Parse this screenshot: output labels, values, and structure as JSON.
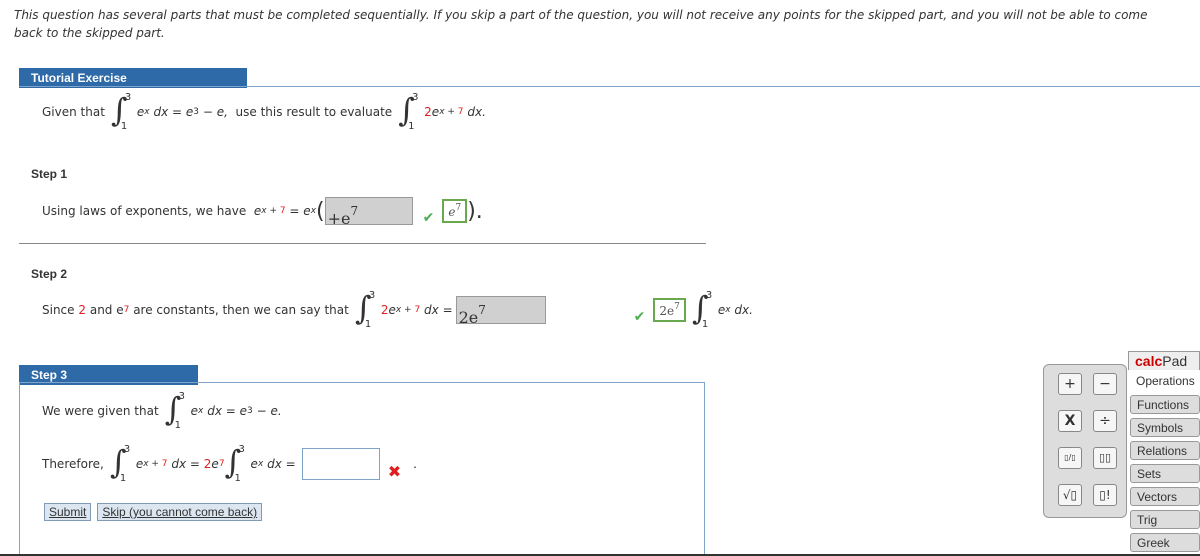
{
  "notice": "This question has several parts that must be completed sequentially. If you skip a part of the question, you will not receive any points for the skipped part, and you will not be able to come back to the skipped part.",
  "header": "Tutorial Exercise",
  "intro": {
    "given": "Given that",
    "upper": "3",
    "lower": "1",
    "e": "e",
    "x": "x",
    "dx": "dx",
    "eq": "= e",
    "three": "3",
    "tail": "− e,",
    "mid": "use this result to evaluate",
    "two": "2",
    "xp": "x + ",
    "seven": "7",
    "dx2": "dx."
  },
  "step1": {
    "title": "Step 1",
    "text": "Using laws of exponents, we have",
    "e": "e",
    "xp": "x + ",
    "seven": "7",
    "eq": "= e",
    "x": "x",
    "paren": "(",
    "answer": "+e",
    "answer_exp": "7",
    "correct": "e",
    "correct_exp": "7",
    "close": ")."
  },
  "step2": {
    "title": "Step 2",
    "since": "Since",
    "two": "2",
    "and": "and e",
    "seven": "7",
    "rest": "are constants, then we can say that",
    "upper": "3",
    "lower": "1",
    "e": "e",
    "xp": "x + ",
    "dx": "dx =",
    "answer": "2e",
    "answer_exp": "7",
    "correct": "2e",
    "correct_exp": "7",
    "x": "x",
    "dx2": "dx."
  },
  "step3": {
    "title": "Step 3",
    "given": "We were given that",
    "upper": "3",
    "lower": "1",
    "e": "e",
    "x": "x",
    "dx": "dx",
    "eq": "= e",
    "three": "3",
    "tail": "− e.",
    "therefore": "Therefore,",
    "xp": "x + ",
    "seven": "7",
    "eqdx": "dx =",
    "two": "2",
    "exp7": "7",
    "dxeq": "dx =",
    "input_value": "",
    "period": ".",
    "submit": "Submit",
    "skip": "Skip (you cannot come back)"
  },
  "calcpad": {
    "brand_red": "calc",
    "brand_rest": "Pad",
    "tabs": [
      "Operations",
      "Functions",
      "Symbols",
      "Relations",
      "Sets",
      "Vectors",
      "Trig",
      "Greek"
    ],
    "keys": [
      "+",
      "−",
      "X",
      "÷",
      "▯/▯",
      "▯▯",
      "√▯",
      "▯!"
    ]
  },
  "colors": {
    "header": "#2e6aa8",
    "red": "#e02020",
    "check": "#4caf50"
  }
}
